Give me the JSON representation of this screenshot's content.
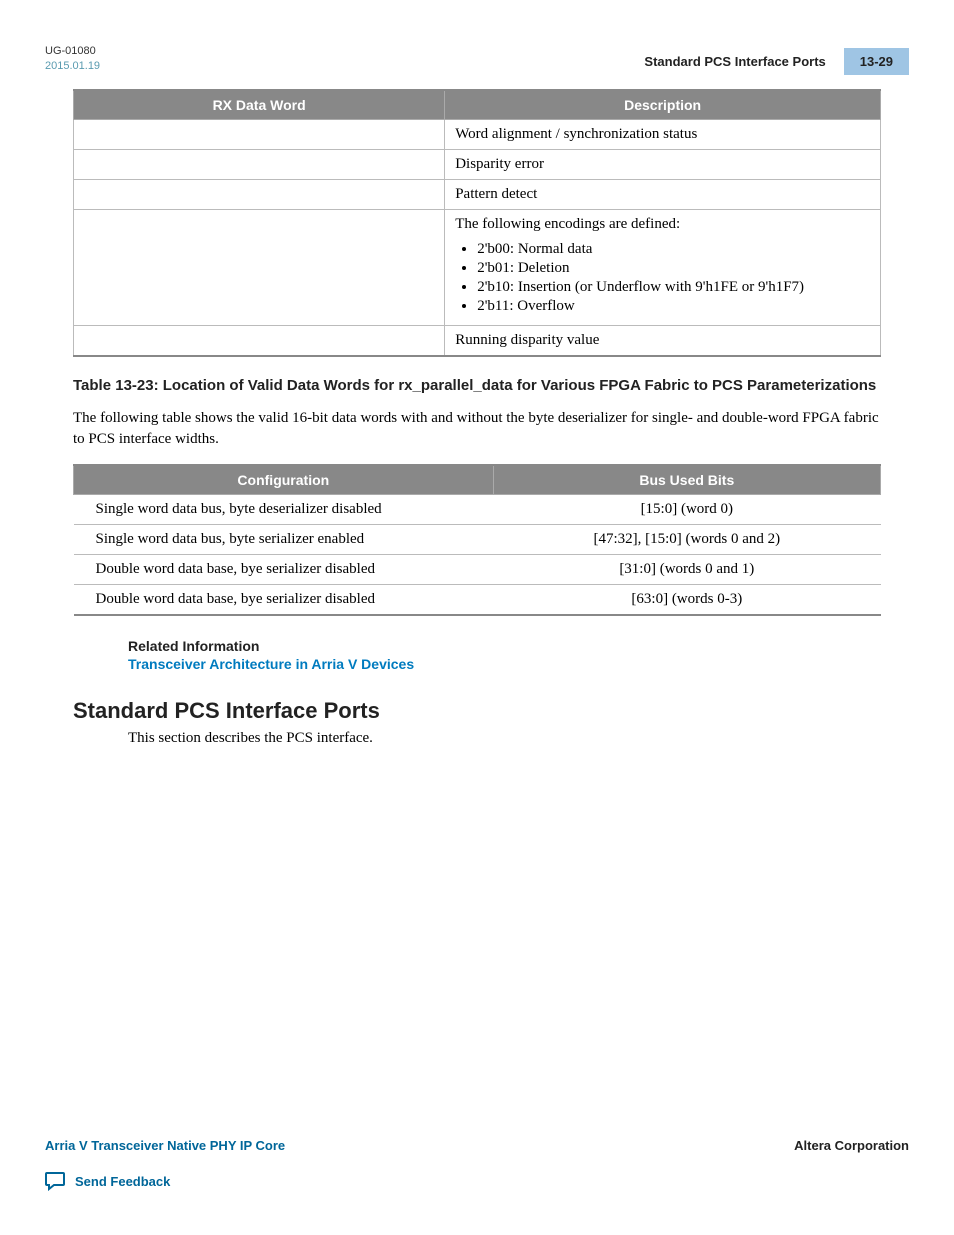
{
  "header": {
    "doc_id": "UG-01080",
    "date": "2015.01.19",
    "section_title": "Standard PCS Interface Ports",
    "page_num": "13-29"
  },
  "table1": {
    "headers": [
      "RX Data Word",
      "Description"
    ],
    "rows": [
      {
        "c1": "",
        "c2": "Word alignment / synchronization status"
      },
      {
        "c1": "",
        "c2": "Disparity error"
      },
      {
        "c1": "",
        "c2": "Pattern detect"
      },
      {
        "c1": "",
        "intro": "The following encodings are defined:",
        "items": [
          "2'b00: Normal data",
          "2'b01: Deletion",
          "2'b10: Insertion (or Underflow with 9'h1FE or 9'h1F7)",
          "2'b11: Overflow"
        ]
      },
      {
        "c1": "",
        "c2": "Running disparity value"
      }
    ]
  },
  "table2_caption": "Table 13-23: Location of Valid Data Words for rx_parallel_data for Various FPGA Fabric to PCS Parameterizations",
  "table2_intro": "The following table shows the valid 16-bit data words with and without the byte deserializer for single- and double-word FPGA fabric to PCS interface widths.",
  "table2": {
    "headers": [
      "Configuration",
      "Bus Used Bits"
    ],
    "rows": [
      {
        "config": "Single word data bus, byte deserializer disabled",
        "bits": "[15:0] (word 0)"
      },
      {
        "config": "Single word data bus, byte serializer enabled",
        "bits": "[47:32], [15:0] (words 0 and 2)"
      },
      {
        "config": "Double word data base, bye serializer disabled",
        "bits": "[31:0] (words 0 and 1)"
      },
      {
        "config": "Double word data base, bye serializer disabled",
        "bits": "[63:0] (words 0-3)"
      }
    ]
  },
  "related": {
    "heading": "Related Information",
    "link_text": "Transceiver Architecture in Arria V Devices"
  },
  "section": {
    "heading": "Standard PCS Interface Ports",
    "body": "This section describes the PCS interface."
  },
  "footer": {
    "left": "Arria V Transceiver Native PHY IP Core",
    "right": "Altera Corporation",
    "feedback": "Send Feedback"
  }
}
